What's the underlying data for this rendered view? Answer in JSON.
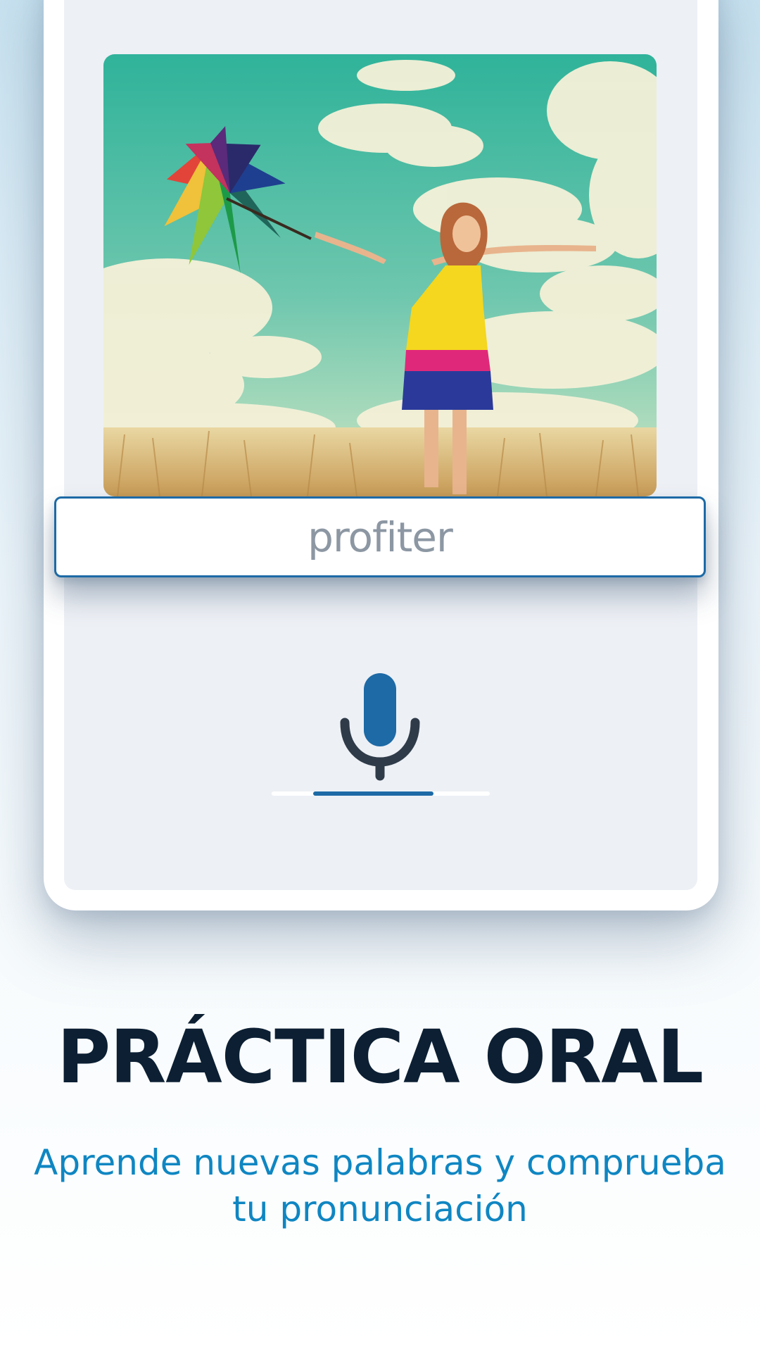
{
  "lesson": {
    "photo": {
      "icon": "photo-woman-rainbow-umbrella"
    },
    "word": "profiter",
    "recorder": {
      "icon": "microphone-icon",
      "level": 0.55
    }
  },
  "feature": {
    "title": "PRÁCTICA ORAL",
    "subtitle_line1": "Aprende nuevas palabras y comprueba",
    "subtitle_line2": "tu pronunciación"
  },
  "colors": {
    "accent": "#1d6aa6",
    "title": "#0c1f33",
    "subtitle": "#0f86c2",
    "word": "#8c97a3",
    "screen": "#edf0f5"
  }
}
